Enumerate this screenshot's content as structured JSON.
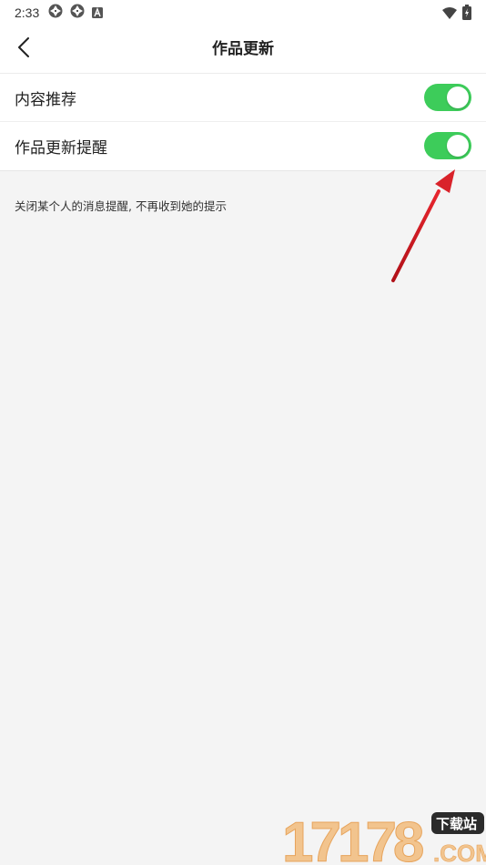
{
  "status_bar": {
    "time": "2:33",
    "left_icons": [
      "aperture-icon",
      "aperture-icon",
      "app-a-icon"
    ],
    "right_icons": [
      "wifi-icon",
      "battery-icon"
    ]
  },
  "header": {
    "title": "作品更新",
    "back_icon": "chevron-left-icon"
  },
  "settings": [
    {
      "label": "内容推荐",
      "enabled": true
    },
    {
      "label": "作品更新提醒",
      "enabled": true
    }
  ],
  "hint": "关闭某个人的消息提醒, 不再收到她的提示",
  "annotation": {
    "type": "arrow",
    "color": "#d9222a"
  },
  "watermark": {
    "number": "17178",
    "suffix": "下载站",
    "domain": ".COM"
  },
  "colors": {
    "toggle_on": "#3dcc5a",
    "background": "#f4f4f4"
  }
}
